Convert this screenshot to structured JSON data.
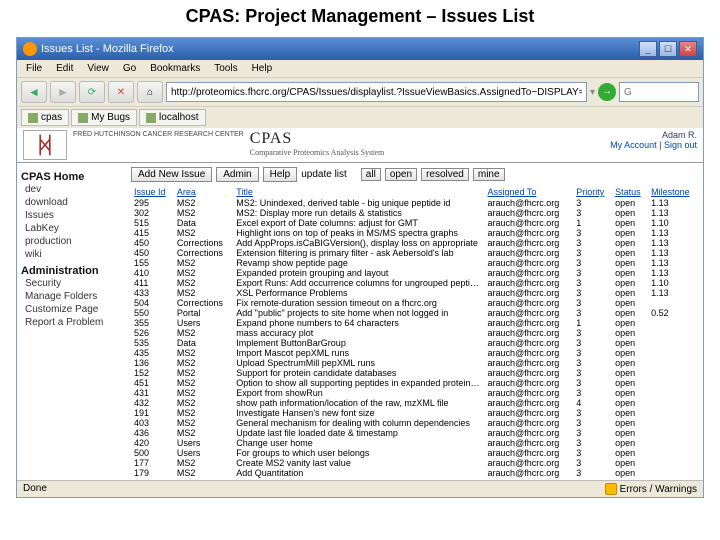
{
  "slide_title": "CPAS: Project Management – Issues List",
  "window_title": "Issues List - Mozilla Firefox",
  "menu": {
    "file": "File",
    "edit": "Edit",
    "view": "View",
    "go": "Go",
    "bookmarks": "Bookmarks",
    "tools": "Tools",
    "help": "Help"
  },
  "url": "http://proteomics.fhcrc.org/CPAS/Issues/displaylist.?IssueViewBasics.AssignedTo~DISPLAY=arauch@fhcrc.org&Issues",
  "search_placeholder": "G",
  "tabs": {
    "t1": "cpas",
    "t2": "My Bugs",
    "t3": "localhost"
  },
  "logo_text": "FRED HUTCHINSON CANCER RESEARCH CENTER",
  "cpas": {
    "title": "CPAS",
    "sub": "Comparative Proteomics Analysis System"
  },
  "account": {
    "user": "Adam R.",
    "link": "My Account",
    "signout": "Sign out"
  },
  "sidebar": {
    "home": "CPAS Home",
    "items1": [
      "dev",
      "download",
      "Issues",
      "LabKey",
      "production",
      "wiki"
    ],
    "admin": "Administration",
    "items2": [
      "Security",
      "Manage Folders",
      "Customize Page",
      "Report a Problem"
    ]
  },
  "buttons": {
    "add": "Add New Issue",
    "admin": "Admin",
    "help": "Help",
    "update": "update list"
  },
  "filters": {
    "all": "all",
    "open": "open",
    "resolved": "resolved",
    "mine": "mine"
  },
  "columns": {
    "id": "Issue Id",
    "area": "Area",
    "title": "Title",
    "assigned": "Assigned To",
    "priority": "Priority",
    "status": "Status",
    "milestone": "Milestone"
  },
  "rows": [
    {
      "id": "295",
      "area": "MS2",
      "title": "MS2: Unindexed, derived table - big unique peptide id",
      "assigned": "arauch@fhcrc.org",
      "pri": "3",
      "status": "open",
      "ms": "1.13"
    },
    {
      "id": "302",
      "area": "MS2",
      "title": "MS2: Display more run details & statistics",
      "assigned": "arauch@fhcrc.org",
      "pri": "3",
      "status": "open",
      "ms": "1.13"
    },
    {
      "id": "515",
      "area": "Data",
      "title": "Excel export of Date columns: adjust for GMT",
      "assigned": "arauch@fhcrc.org",
      "pri": "1",
      "status": "open",
      "ms": "1.10"
    },
    {
      "id": "415",
      "area": "MS2",
      "title": "Highlight ions on top of peaks in MS/MS spectra graphs",
      "assigned": "arauch@fhcrc.org",
      "pri": "3",
      "status": "open",
      "ms": "1.13"
    },
    {
      "id": "450",
      "area": "Corrections",
      "title": "Add AppProps.isCaBIGVersion(), display loss on appropriate",
      "assigned": "arauch@fhcrc.org",
      "pri": "3",
      "status": "open",
      "ms": "1.13"
    },
    {
      "id": "450",
      "area": "Corrections",
      "title": "Extension filtering is primary filter - ask Aebersold's lab",
      "assigned": "arauch@fhcrc.org",
      "pri": "3",
      "status": "open",
      "ms": "1.13"
    },
    {
      "id": "155",
      "area": "MS2",
      "title": "Revamp show peptide page",
      "assigned": "arauch@fhcrc.org",
      "pri": "3",
      "status": "open",
      "ms": "1.13"
    },
    {
      "id": "410",
      "area": "MS2",
      "title": "Expanded protein grouping and layout",
      "assigned": "arauch@fhcrc.org",
      "pri": "3",
      "status": "open",
      "ms": "1.13"
    },
    {
      "id": "411",
      "area": "MS2",
      "title": "Export Runs: Add occurrence columns for ungrouped peptides",
      "assigned": "arauch@fhcrc.org",
      "pri": "3",
      "status": "open",
      "ms": "1.10"
    },
    {
      "id": "433",
      "area": "MS2",
      "title": "XSL Performance Problems",
      "assigned": "arauch@fhcrc.org",
      "pri": "3",
      "status": "open",
      "ms": "1.13"
    },
    {
      "id": "504",
      "area": "Corrections",
      "title": "Fix remote-duration session timeout on a fhcrc.org",
      "assigned": "arauch@fhcrc.org",
      "pri": "3",
      "status": "open",
      "ms": ""
    },
    {
      "id": "550",
      "area": "Portal",
      "title": "Add \"public\" projects to site home when not logged in",
      "assigned": "arauch@fhcrc.org",
      "pri": "3",
      "status": "open",
      "ms": "0.52"
    },
    {
      "id": "355",
      "area": "Users",
      "title": "Expand phone numbers to 64 characters",
      "assigned": "arauch@fhcrc.org",
      "pri": "1",
      "status": "open",
      "ms": ""
    },
    {
      "id": "526",
      "area": "MS2",
      "title": "mass accuracy plot",
      "assigned": "arauch@fhcrc.org",
      "pri": "3",
      "status": "open",
      "ms": ""
    },
    {
      "id": "535",
      "area": "Data",
      "title": "Implement ButtonBarGroup",
      "assigned": "arauch@fhcrc.org",
      "pri": "3",
      "status": "open",
      "ms": ""
    },
    {
      "id": "435",
      "area": "MS2",
      "title": "Import Mascot pepXML runs",
      "assigned": "arauch@fhcrc.org",
      "pri": "3",
      "status": "open",
      "ms": ""
    },
    {
      "id": "136",
      "area": "MS2",
      "title": "Upload SpectrumMill pepXML runs",
      "assigned": "arauch@fhcrc.org",
      "pri": "3",
      "status": "open",
      "ms": ""
    },
    {
      "id": "152",
      "area": "MS2",
      "title": "Support for protein candidate databases",
      "assigned": "arauch@fhcrc.org",
      "pri": "3",
      "status": "open",
      "ms": ""
    },
    {
      "id": "451",
      "area": "MS2",
      "title": "Option to show all supporting peptides in expanded protein view",
      "assigned": "arauch@fhcrc.org",
      "pri": "3",
      "status": "open",
      "ms": ""
    },
    {
      "id": "431",
      "area": "MS2",
      "title": "Export from showRun",
      "assigned": "arauch@fhcrc.org",
      "pri": "3",
      "status": "open",
      "ms": ""
    },
    {
      "id": "432",
      "area": "MS2",
      "title": "show path information/location of the raw, mzXML file",
      "assigned": "arauch@fhcrc.org",
      "pri": "4",
      "status": "open",
      "ms": ""
    },
    {
      "id": "191",
      "area": "MS2",
      "title": "Investigate Hansen's new font size",
      "assigned": "arauch@fhcrc.org",
      "pri": "3",
      "status": "open",
      "ms": ""
    },
    {
      "id": "403",
      "area": "MS2",
      "title": "General mechanism for dealing with column dependencies",
      "assigned": "arauch@fhcrc.org",
      "pri": "3",
      "status": "open",
      "ms": ""
    },
    {
      "id": "436",
      "area": "MS2",
      "title": "Update last file loaded date & timestamp",
      "assigned": "arauch@fhcrc.org",
      "pri": "3",
      "status": "open",
      "ms": ""
    },
    {
      "id": "420",
      "area": "Users",
      "title": "Change user home",
      "assigned": "arauch@fhcrc.org",
      "pri": "3",
      "status": "open",
      "ms": ""
    },
    {
      "id": "500",
      "area": "Users",
      "title": "For groups to which user belongs",
      "assigned": "arauch@fhcrc.org",
      "pri": "3",
      "status": "open",
      "ms": ""
    },
    {
      "id": "177",
      "area": "MS2",
      "title": "Create MS2 vanity last value",
      "assigned": "arauch@fhcrc.org",
      "pri": "3",
      "status": "open",
      "ms": ""
    },
    {
      "id": "179",
      "area": "MS2",
      "title": "Add Quantitation",
      "assigned": "arauch@fhcrc.org",
      "pri": "3",
      "status": "open",
      "ms": ""
    }
  ],
  "status": {
    "done": "Done",
    "warnings": "Errors / Warnings"
  }
}
